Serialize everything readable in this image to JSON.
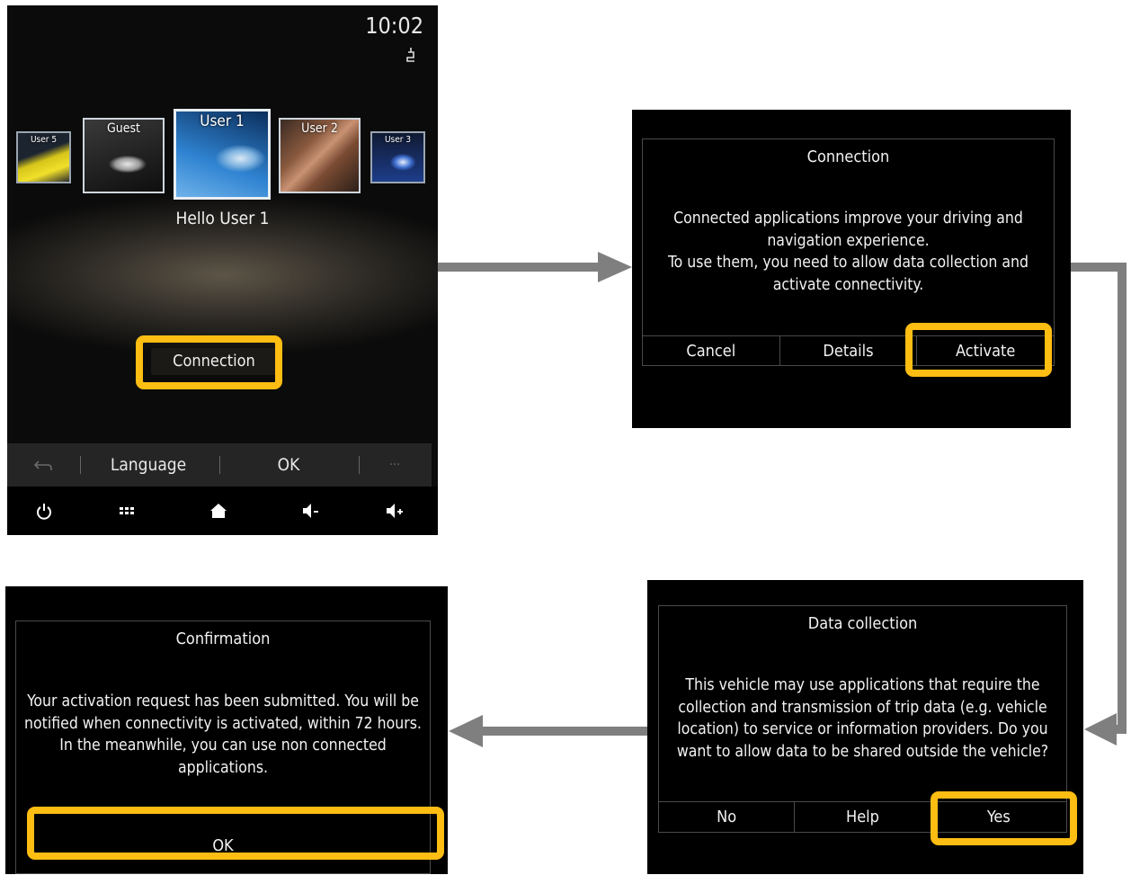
{
  "home": {
    "clock": "10:02",
    "status_icon": "seat-icon",
    "profiles": [
      {
        "label": "User 5"
      },
      {
        "label": "Guest"
      },
      {
        "label": "User 1"
      },
      {
        "label": "User 2"
      },
      {
        "label": "User 3"
      }
    ],
    "greeting": "Hello User 1",
    "connection_button": "Connection",
    "menu": {
      "language": "Language",
      "ok": "OK",
      "more": "···"
    },
    "nav_icons": [
      "power-icon",
      "grid-menu-icon",
      "home-icon",
      "volume-down-icon",
      "volume-up-icon"
    ]
  },
  "connection_dialog": {
    "title": "Connection",
    "body_lines": [
      "Connected applications improve your driving and",
      "navigation experience.",
      "To use them, you need to allow data collection and",
      "activate connectivity."
    ],
    "buttons": {
      "cancel": "Cancel",
      "details": "Details",
      "activate": "Activate"
    }
  },
  "data_collection_dialog": {
    "title": "Data collection",
    "body_lines": [
      "This vehicle may use applications that require the",
      "collection and transmission of trip data (e.g. vehicle",
      "location) to service or information providers. Do you",
      "want to allow data to be shared outside the vehicle?"
    ],
    "buttons": {
      "no": "No",
      "help": "Help",
      "yes": "Yes"
    }
  },
  "confirmation_dialog": {
    "title": "Confirmation",
    "body_lines": [
      "Your activation request has been submitted. You will be",
      "notified when connectivity is activated, within 72 hours.",
      "In the meanwhile, you can use non connected",
      "applications."
    ],
    "buttons": {
      "ok": "OK"
    }
  },
  "colors": {
    "highlight": "#fdbd12",
    "arrow": "#7f7f7f",
    "screen_bg": "#000000"
  }
}
